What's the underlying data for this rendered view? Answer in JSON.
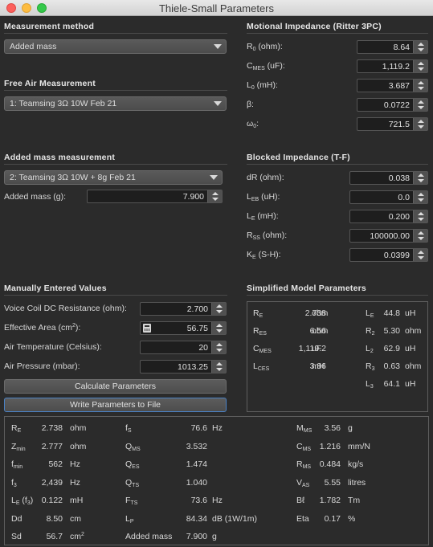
{
  "window": {
    "title": "Thiele-Small Parameters"
  },
  "sections": {
    "method": "Measurement method",
    "motional": "Motional Impedance (Ritter 3PC)",
    "free_air": "Free Air Measurement",
    "added_mass": "Added mass measurement",
    "blocked": "Blocked Impedance (T-F)",
    "manual": "Manually Entered Values",
    "simplified": "Simplified Model Parameters"
  },
  "method_select": "Added mass",
  "free_air_select": "1: Teamsing 3Ω 10W Feb 21",
  "added_mass_select": "2: Teamsing 3Ω 10W + 8g Feb 21",
  "added_mass_field": {
    "label": "Added mass (g):",
    "value": "7.900"
  },
  "motional": [
    {
      "sym": "R",
      "sub": "0",
      "unit": " (ohm):",
      "value": "8.64"
    },
    {
      "sym": "C",
      "sub": "MES",
      "unit": " (uF):",
      "value": "1,119.2"
    },
    {
      "sym": "L",
      "sub": "0",
      "unit": " (mH):",
      "value": "3.687"
    },
    {
      "sym": "β:",
      "sub": "",
      "unit": "",
      "value": "0.0722"
    },
    {
      "sym": "ω",
      "sub": "0",
      "unit": ":",
      "value": "721.5"
    }
  ],
  "blocked": [
    {
      "sym": "dR (ohm):",
      "sub": "",
      "unit": "",
      "value": "0.038"
    },
    {
      "sym": "L",
      "sub": "EB",
      "unit": " (uH):",
      "value": "0.0"
    },
    {
      "sym": "L",
      "sub": "E",
      "unit": " (mH):",
      "value": "0.200"
    },
    {
      "sym": "R",
      "sub": "SS",
      "unit": " (ohm):",
      "value": "100000.00"
    },
    {
      "sym": "K",
      "sub": "E",
      "unit": " (S-H):",
      "value": "0.0399"
    }
  ],
  "manual": [
    {
      "label": "Voice Coil DC Resistance (ohm):",
      "value": "2.700"
    },
    {
      "label": "Effective Area (cm",
      "sup": "2",
      "label_end": "):",
      "value": "56.75"
    },
    {
      "label": "Air Temperature (Celsius):",
      "value": "20"
    },
    {
      "label": "Air Pressure (mbar):",
      "value": "1013.25"
    }
  ],
  "buttons": {
    "calculate": "Calculate Parameters",
    "write": "Write Parameters to File"
  },
  "simplified_left": [
    {
      "sym": "R",
      "sub": "E",
      "value": "2.738",
      "unit": "ohm"
    },
    {
      "sym": "R",
      "sub": "ES",
      "value": "6.56",
      "unit": "ohm"
    },
    {
      "sym": "C",
      "sub": "MES",
      "value": "1,119.2",
      "unit": "uF"
    },
    {
      "sym": "L",
      "sub": "CES",
      "value": "3.86",
      "unit": "mH"
    }
  ],
  "simplified_right": [
    {
      "sym": "L",
      "sub": "E",
      "value": "44.8",
      "unit": "uH"
    },
    {
      "sym": "R",
      "sub": "2",
      "value": "5.30",
      "unit": "ohm"
    },
    {
      "sym": "L",
      "sub": "2",
      "value": "62.9",
      "unit": "uH"
    },
    {
      "sym": "R",
      "sub": "3",
      "value": "0.63",
      "unit": "ohm"
    },
    {
      "sym": "L",
      "sub": "3",
      "value": "64.1",
      "unit": "uH"
    }
  ],
  "results_col1": [
    {
      "sym": "R",
      "sub": "E",
      "value": "2.738",
      "unit": "ohm"
    },
    {
      "sym": "Z",
      "sub": "min",
      "value": "2.777",
      "unit": "ohm"
    },
    {
      "sym": "f",
      "sub": "min",
      "value": "562",
      "unit": "Hz"
    },
    {
      "sym": "f",
      "sub": "3",
      "value": "2,439",
      "unit": "Hz"
    },
    {
      "sym": "L",
      "sub": "E",
      "mid": " (f",
      "sub2": "3",
      "end": ")",
      "value": "0.122",
      "unit": "mH"
    },
    {
      "sym": "Dd",
      "sub": "",
      "value": "8.50",
      "unit": "cm"
    },
    {
      "sym": "Sd",
      "sub": "",
      "value": "56.7",
      "unit": "cm",
      "unit_sup": "2"
    }
  ],
  "results_col2": [
    {
      "sym": "f",
      "sub": "S",
      "value": "76.6",
      "unit": "Hz"
    },
    {
      "sym": "Q",
      "sub": "MS",
      "value": "3.532",
      "unit": ""
    },
    {
      "sym": "Q",
      "sub": "ES",
      "value": "1.474",
      "unit": ""
    },
    {
      "sym": "Q",
      "sub": "TS",
      "value": "1.040",
      "unit": ""
    },
    {
      "sym": "F",
      "sub": "TS",
      "value": "73.6",
      "unit": "Hz"
    },
    {
      "sym": "L",
      "sub": "P",
      "value": "84.34",
      "unit": "dB (1W/1m)"
    },
    {
      "sym": "Added mass",
      "sub": "",
      "value": "7.900",
      "unit": "g"
    }
  ],
  "results_col3": [
    {
      "sym": "M",
      "sub": "MS",
      "value": "3.56",
      "unit": "g"
    },
    {
      "sym": "C",
      "sub": "MS",
      "value": "1.216",
      "unit": "mm/N"
    },
    {
      "sym": "R",
      "sub": "MS",
      "value": "0.484",
      "unit": "kg/s"
    },
    {
      "sym": "V",
      "sub": "AS",
      "value": "5.55",
      "unit": "litres"
    },
    {
      "sym": "Bℓ",
      "sub": "",
      "value": "1.782",
      "unit": "Tm"
    },
    {
      "sym": "Eta",
      "sub": "",
      "value": "0.17",
      "unit": "%"
    }
  ]
}
